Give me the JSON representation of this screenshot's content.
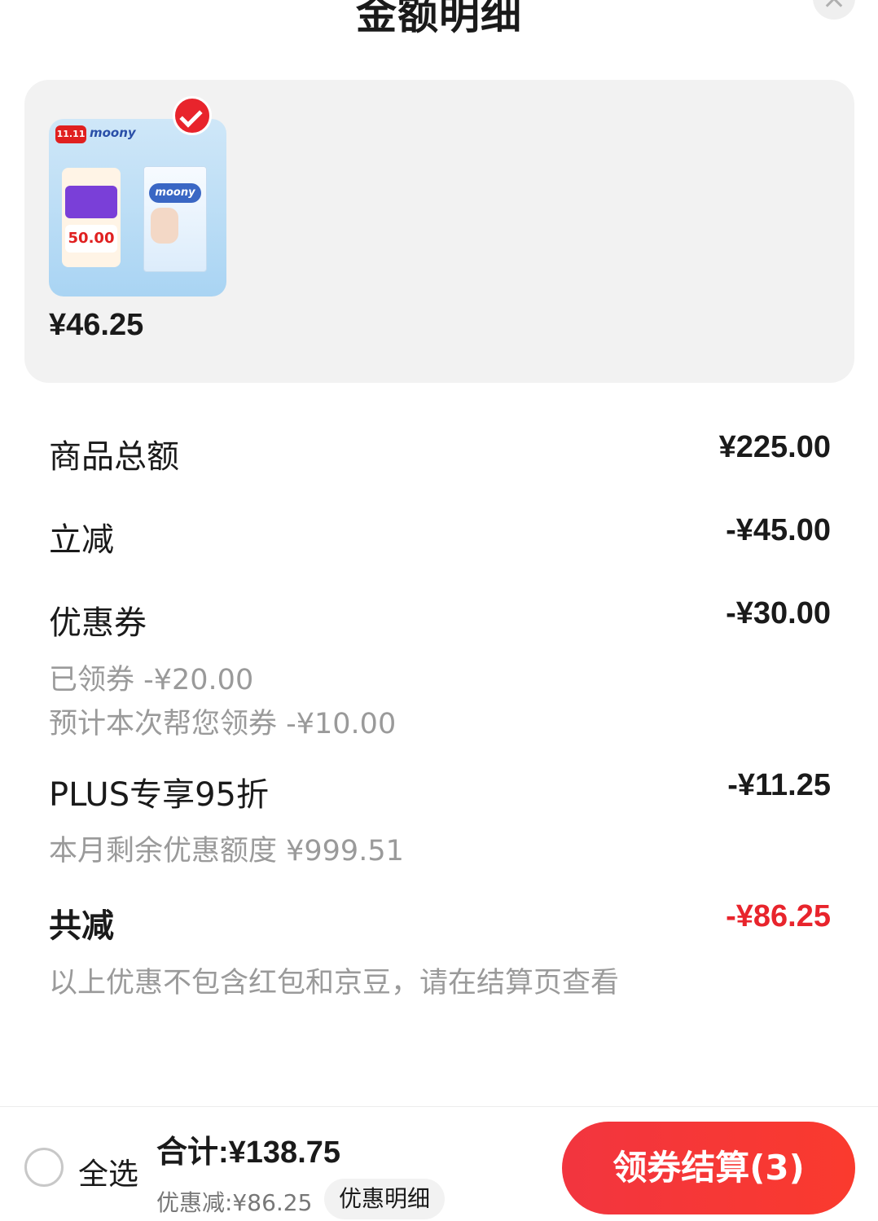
{
  "header": {
    "title": "金额明细"
  },
  "product": {
    "price": "¥46.25",
    "thumb_badge": "11.11",
    "thumb_brand": "moony",
    "thumb_price": "50.00"
  },
  "details": {
    "goods_total": {
      "label": "商品总额",
      "value": "¥225.00"
    },
    "instant_discount": {
      "label": "立减",
      "value": "-¥45.00"
    },
    "coupon": {
      "label": "优惠券",
      "value": "-¥30.00",
      "claimed": "已领券 -¥20.00",
      "auto_claim": "预计本次帮您领券 -¥10.00"
    },
    "plus": {
      "label": "PLUS专享95折",
      "value": "-¥11.25",
      "remaining": "本月剩余优惠额度 ¥999.51"
    },
    "total_discount": {
      "label": "共减",
      "value": "-¥86.25",
      "note": "以上优惠不包含红包和京豆，请在结算页查看"
    }
  },
  "bottom_bar": {
    "select_all": "全选",
    "total": "合计:¥138.75",
    "discount": "优惠减:¥86.25",
    "detail_link": "优惠明细",
    "checkout": "领券结算(3)"
  },
  "colors": {
    "accent": "#e8242c",
    "card_bg": "#f2f2f2",
    "muted_text": "#9a9a9a"
  }
}
